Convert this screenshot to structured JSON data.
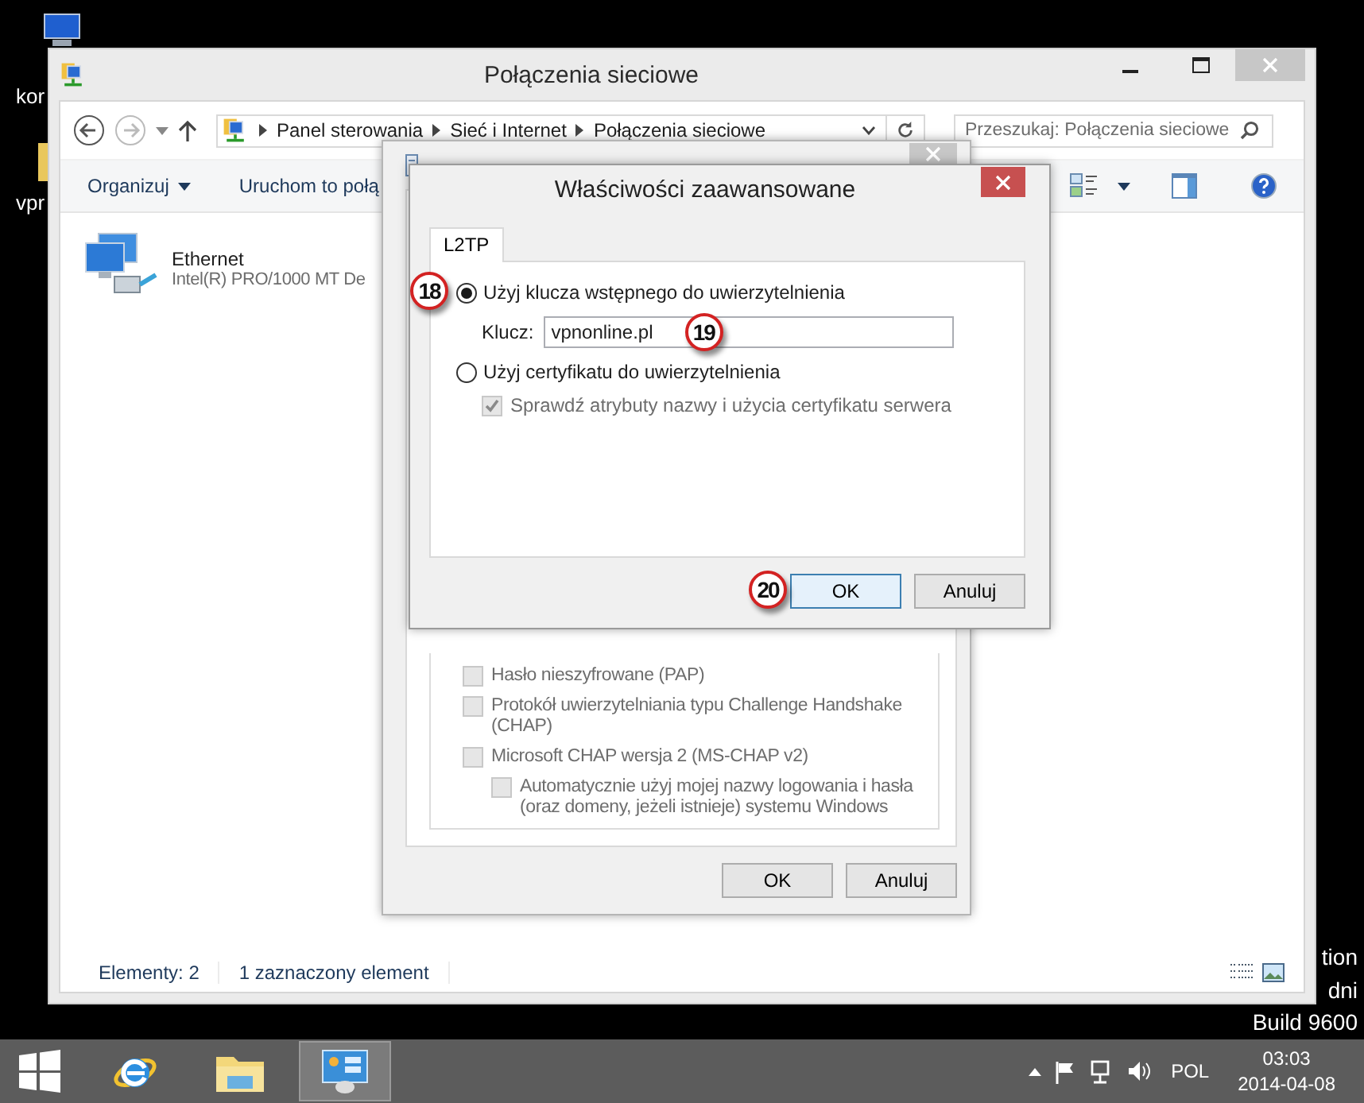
{
  "desktop": {
    "icon_labels": [
      "kor",
      "vpr"
    ],
    "corner_text": [
      "tion",
      "dni",
      "Build 9600"
    ]
  },
  "explorer": {
    "title": "Połączenia sieciowe",
    "active": false,
    "address": [
      "Panel sterowania",
      "Sieć i Internet",
      "Połączenia sieciowe"
    ],
    "search": {
      "placeholder": "Przeszukaj: Połączenia sieciowe"
    },
    "toolbar": [
      "Organizuj",
      "Uruchom to połą"
    ],
    "items": [
      {
        "name": "Ethernet",
        "detail": "Intel(R) PRO/1000 MT De"
      }
    ],
    "status": [
      "Elementy: 2",
      "1 zaznaczony element"
    ]
  },
  "properties_dialog": {
    "active": false,
    "options": [
      {
        "label": "Hasło nieszyfrowane (PAP)",
        "checked": false,
        "disabled": true
      },
      {
        "label": "Protokół uwierzytelniania typu Challenge Handshake (CHAP)",
        "checked": false,
        "disabled": true
      },
      {
        "label": "Microsoft CHAP wersja 2 (MS-CHAP v2)",
        "checked": false,
        "disabled": true,
        "children": [
          {
            "label": "Automatycznie użyj mojej nazwy logowania i hasła (oraz domeny, jeżeli istnieje) systemu Windows",
            "checked": false,
            "disabled": true
          }
        ]
      }
    ],
    "buttons": [
      {
        "label": "OK",
        "default": false
      },
      {
        "label": "Anuluj",
        "default": false
      }
    ]
  },
  "advanced_dialog": {
    "title": "Właściwości zaawansowane",
    "active": true,
    "tabs": [
      {
        "label": "L2TP",
        "selected": true
      }
    ],
    "options": [
      {
        "kind": "radio",
        "label": "Użyj klucza wstępnego do uwierzytelnienia",
        "selected": true,
        "callout": "18"
      },
      {
        "kind": "field",
        "label": "Klucz:",
        "value": "vpnonline.pl",
        "callout": "19"
      },
      {
        "kind": "radio",
        "label": "Użyj certyfikatu do uwierzytelnienia",
        "selected": false
      },
      {
        "kind": "checkbox",
        "label": "Sprawdź atrybuty nazwy i użycia certyfikatu serwera",
        "checked": true,
        "disabled": true
      }
    ],
    "buttons": [
      {
        "label": "OK",
        "default": true,
        "callout": "20"
      },
      {
        "label": "Anuluj",
        "default": false
      }
    ]
  },
  "taskbar": {
    "apps": [
      {
        "kind": "browser",
        "selected": false
      },
      {
        "kind": "files",
        "selected": false
      },
      {
        "kind": "control-panel",
        "selected": true
      }
    ],
    "language": "POL",
    "time": "03:03",
    "date": "2014-04-08"
  }
}
